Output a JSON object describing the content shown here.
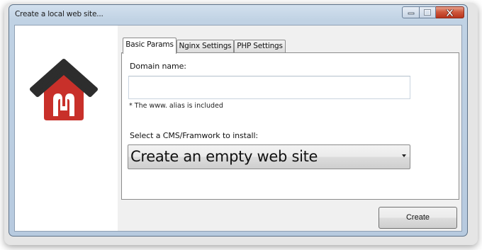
{
  "window": {
    "title": "Create a local web site..."
  },
  "tabs": [
    {
      "label": "Basic Params",
      "active": true
    },
    {
      "label": "Nginx Settings",
      "active": false
    },
    {
      "label": "PHP Settings",
      "active": false
    }
  ],
  "form": {
    "domain_label": "Domain name:",
    "domain_value": "",
    "domain_note": "* The www. alias is included",
    "cms_label": "Select a CMS/Framwork to install:",
    "cms_selected": "Create an empty web site"
  },
  "buttons": {
    "create_label": "Create"
  },
  "icons": {
    "logo": "house-logo-icon",
    "minimize": "minimize-icon",
    "maximize": "maximize-icon",
    "close": "close-icon",
    "dropdown": "chevron-down-icon"
  },
  "colors": {
    "logo_roof": "#2d2d2d",
    "logo_body": "#c8302a"
  }
}
